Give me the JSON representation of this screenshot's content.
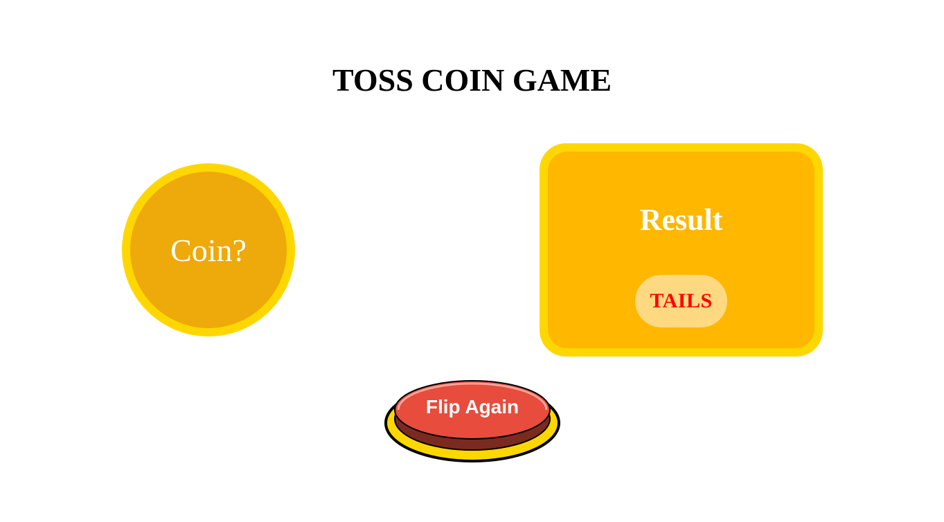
{
  "game": {
    "title": "TOSS COIN GAME"
  },
  "coin": {
    "label": "Coin?"
  },
  "result": {
    "title": "Result",
    "value": "TAILS"
  },
  "controls": {
    "flip_label": "Flip Again"
  },
  "colors": {
    "coin_rim": "#FFD700",
    "coin_face": "#EEA90A",
    "card_border": "#FFD700",
    "card_fill": "#FFB700",
    "pill_fill": "#FFD982",
    "result_text": "#FF0000",
    "button_red": "#E74C3C",
    "button_base": "#7B2A1F"
  }
}
